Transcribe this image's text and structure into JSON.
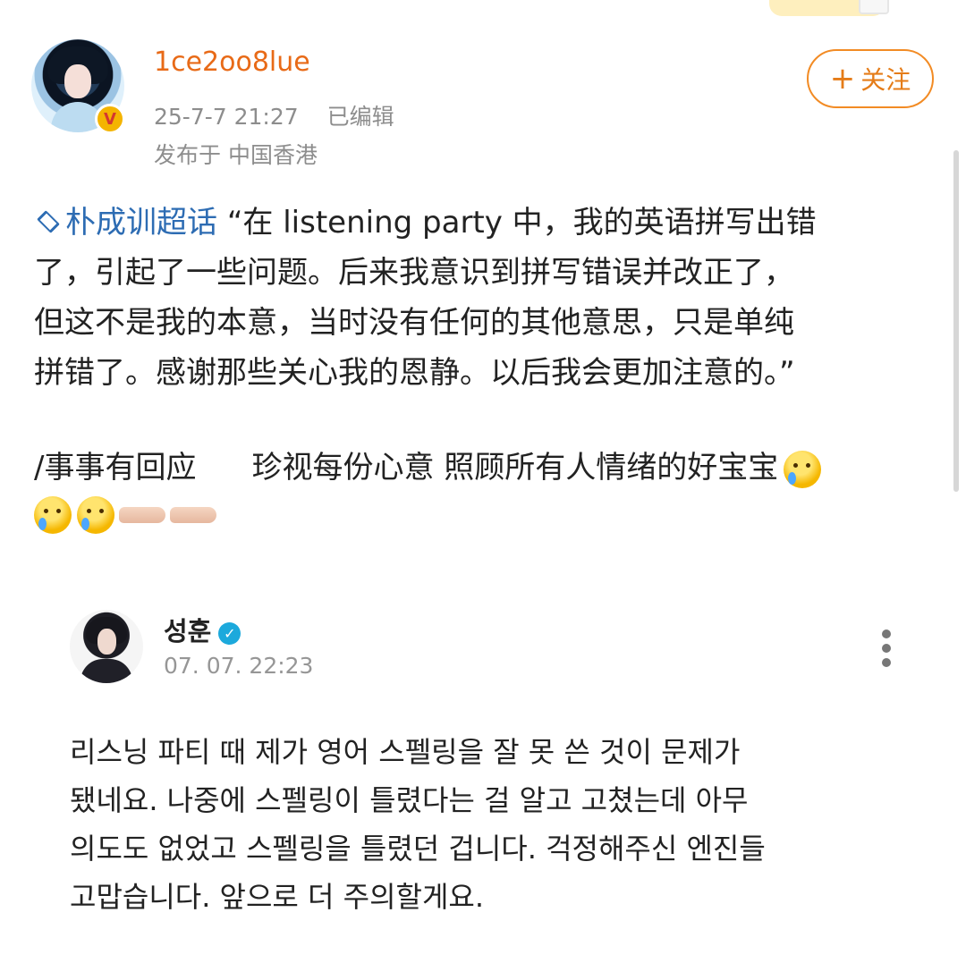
{
  "post": {
    "username": "1ce2oo8lue",
    "timestamp": "25-7-7 21:27",
    "edited": "已编辑",
    "location": "发布于 中国香港",
    "follow_button": "关注",
    "topic": "朴成训超话",
    "body_lines": [
      "“在 listening party 中，我的英语拼写出错",
      "了，引起了一些问题。后来我意识到拼写错误并改正了，",
      "但这不是我的本意，当时没有任何的其他意思，只是单纯",
      "拼错了。感谢那些关心我的恩静。以后我会更加注意的。”"
    ],
    "tags_text": {
      "start": "/事事有回应",
      "end": "珍视每份心意 照顾所有人情绪的好宝宝"
    }
  },
  "reply": {
    "name": "성훈",
    "time": "07. 07. 22:23",
    "body_lines": [
      "리스닝 파티 때 제가 영어 스펠링을 잘 못 쓴 것이 문제가",
      "됐네요. 나중에 스펠링이 틀렸다는 걸 알고 고쳤는데 아무",
      "의도도 없었고 스펠링을 틀렸던 겁니다. 걱정해주신 엔진들",
      "고맙습니다. 앞으로 더 주의할게요."
    ]
  },
  "icons": {
    "verified_badge": "V",
    "topic_icon": "diamond-icon",
    "more_icon": "more-vertical-icon",
    "reply_verified": "check-icon"
  },
  "colors": {
    "accent": "#e86a17",
    "link": "#2d6cb3",
    "meta": "#8d8d8d",
    "verified": "#1ca9dc"
  }
}
